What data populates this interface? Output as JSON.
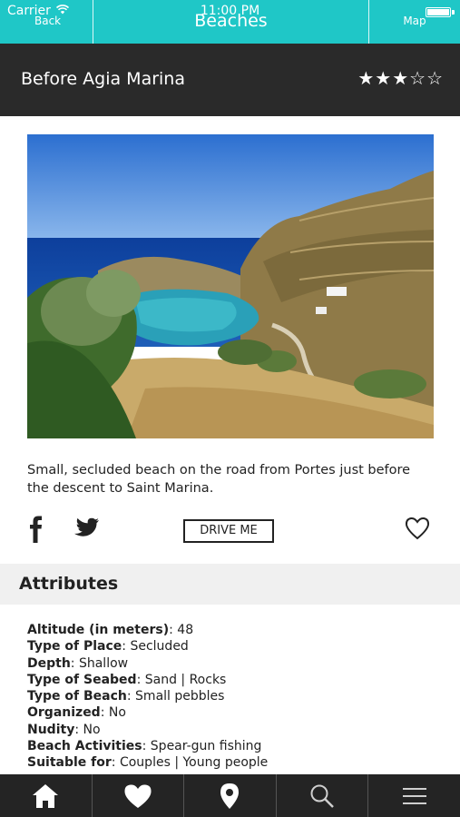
{
  "status_bar": {
    "carrier": "Carrier",
    "time": "11:00 PM"
  },
  "nav": {
    "back_label": "Back",
    "title": "Beaches",
    "map_label": "Map"
  },
  "beach": {
    "name": "Before Agia Marina",
    "rating": 3,
    "rating_max": 5,
    "stars_text": "★★★☆☆",
    "description": "Small, secluded beach on the road from Portes just before the descent to Saint Marina."
  },
  "actions": {
    "drive_label": "DRIVE ME"
  },
  "attributes": {
    "header": "Attributes",
    "items": [
      {
        "label": "Altitude (in meters)",
        "value": "48"
      },
      {
        "label": "Type of Place",
        "value": "Secluded"
      },
      {
        "label": "Depth",
        "value": "Shallow"
      },
      {
        "label": "Type of Seabed",
        "value": "Sand | Rocks"
      },
      {
        "label": "Type of Beach",
        "value": "Small pebbles"
      },
      {
        "label": "Organized",
        "value": "No"
      },
      {
        "label": "Nudity",
        "value": "No"
      },
      {
        "label": "Beach Activities",
        "value": "Spear-gun fishing"
      },
      {
        "label": "Suitable for",
        "value": "Couples | Young people"
      }
    ]
  },
  "tabbar": {
    "icons": [
      "home-icon",
      "heart-icon",
      "map-pin-icon",
      "search-icon",
      "menu-icon"
    ]
  },
  "colors": {
    "nav_bg": "#1fc7c7",
    "title_bg": "#2a2a2a",
    "tabbar_bg": "#242424",
    "attr_header_bg": "#f0f0f0"
  }
}
